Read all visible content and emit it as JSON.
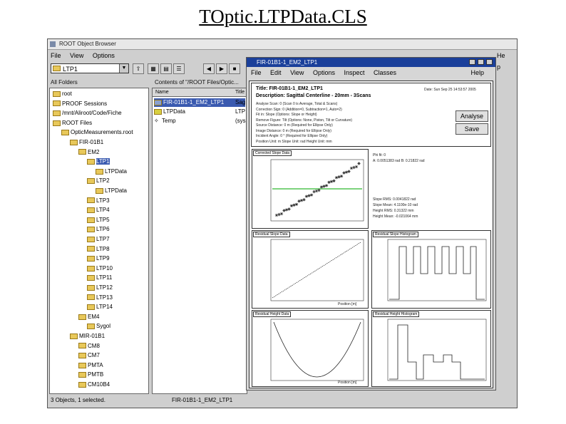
{
  "slide_title": "TOptic.LTPData.CLS",
  "browser": {
    "title": "ROOT Object Browser",
    "menu": [
      "File",
      "View",
      "Options",
      "He p"
    ],
    "combo_value": "LTP1",
    "folders_header": "All Folders",
    "contents_header": "Contents of \"/ROOT Files/Optic...",
    "list_header_name": "Name",
    "list_header_title": "Title",
    "tree_items": [
      "root",
      "PROOF Sessions",
      "/mnt/Aliroot/Code/Fiche",
      "ROOT Files",
      "OpticMeasurements.root",
      "FIR-01B1",
      "EM2",
      "LTP1",
      "LTPData",
      "LTP2",
      "LTPData",
      "LTP3",
      "LTP4",
      "LTP5",
      "LTP6",
      "LTP7",
      "LTP8",
      "LTP9",
      "LTP10",
      "LTP11",
      "LTP12",
      "LTP13",
      "LTP14",
      "EM4",
      "Sygol",
      "MIR-01B1",
      "CM8",
      "CM7",
      "PMTA",
      "PMTB",
      "CM10B4"
    ],
    "list_items": [
      {
        "name": "FIR-01B1-1_EM2_LTP1",
        "title": "Sag"
      },
      {
        "name": "LTPData",
        "title": "LTP"
      },
      {
        "name": "Temp",
        "title": "(sys"
      }
    ],
    "status_left": "3 Objects, 1 selected.",
    "status_right": "FIR-01B1-1_EM2_LTP1"
  },
  "canvas_window": {
    "title": "FIR-01B1-1_EM2_LTP1",
    "menu": [
      "File",
      "Edit",
      "View",
      "Options",
      "Inspect",
      "Classes"
    ],
    "help": "Help",
    "title_text": "Title: FIR-01B1-1_EM2_LTP1",
    "date_text": "Date: Sun Sep 25 14:53:57 2005",
    "description_text": "Description: Sagittal Centerline - 20mm - 3Scans",
    "params": [
      "Analyse Scan: 0 (Scan 0 is Average, Total & Scans)",
      "Correction Sign: 0 (Addition=0, Subtraction=1, Auto=2)",
      "Fit in: Slope (Options: Slope or Height)",
      "Remove Figure: Tilt (Options: None, Piston, Tilt or Curvature)",
      "Source Distance: 0 m (Required for Ellipse Only)",
      "Image Distance: 0 m (Required for Ellipse Only)",
      "Incident Angle: 0 ° (Required for Ellipse Only)",
      "Position Unit: m     Slope Unit: rad     Height Unit: mm"
    ],
    "analyse_label": "Analyse",
    "save_label": "Save",
    "fit_params": [
      "Phi fit: 0",
      "A: 0.0051383 rad     B: 0.21822 rad",
      "Slope RMS: 0.0041822 rad",
      "Slope Mean: 4.1100e-10 rad",
      "Height RMS: 0.31322 mm",
      "Height Mean: -0.021064 mm"
    ],
    "panel_titles": [
      "Corrected Slope Data",
      "Residual Slope Data",
      "Residual Slope Histogram",
      "Residual Height Data",
      "Residual Height Histogram"
    ],
    "axis_x_label": "Position [m]"
  },
  "icons": [
    "folder-icon",
    "up-folder-icon",
    "list-view-icon",
    "detail-view-icon",
    "back-icon",
    "forward-icon"
  ]
}
